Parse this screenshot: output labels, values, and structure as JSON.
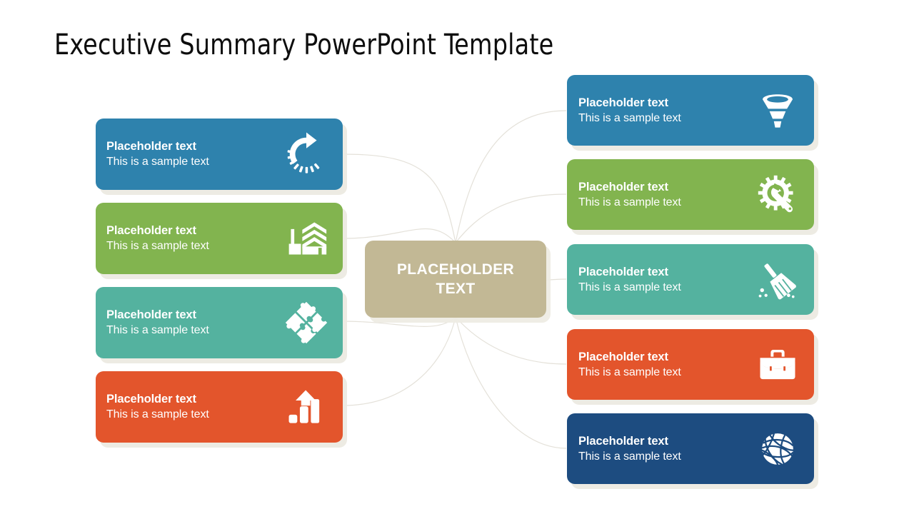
{
  "slide": {
    "title": "Executive Summary PowerPoint Template",
    "background_color": "#ffffff"
  },
  "center": {
    "label_line1": "PLACEHOLDER",
    "label_line2": "TEXT",
    "color": "#c2b895",
    "text_color": "#ffffff"
  },
  "connector_color": "#e4e1d9",
  "left_cards": [
    {
      "title": "Placeholder text",
      "subtitle": "This is a sample text",
      "color": "#2e82ad",
      "icon": "refresh-circular-arrow-icon"
    },
    {
      "title": "Placeholder text",
      "subtitle": "This is a sample text",
      "color": "#82b44f",
      "icon": "office-building-icon"
    },
    {
      "title": "Placeholder text",
      "subtitle": "This is a sample text",
      "color": "#54b29f",
      "icon": "puzzle-pieces-icon"
    },
    {
      "title": "Placeholder text",
      "subtitle": "This is a sample text",
      "color": "#e3552c",
      "icon": "growth-bar-chart-arrow-icon"
    }
  ],
  "right_cards": [
    {
      "title": "Placeholder text",
      "subtitle": "This is a sample text",
      "color": "#2e82ad",
      "icon": "funnel-icon"
    },
    {
      "title": "Placeholder text",
      "subtitle": "This is a sample text",
      "color": "#82b44f",
      "icon": "gear-wrench-icon"
    },
    {
      "title": "Placeholder text",
      "subtitle": "This is a sample text",
      "color": "#54b29f",
      "icon": "broom-icon"
    },
    {
      "title": "Placeholder text",
      "subtitle": "This is a sample text",
      "color": "#e3552c",
      "icon": "briefcase-icon"
    },
    {
      "title": "Placeholder text",
      "subtitle": "This is a sample text",
      "color": "#1d4c80",
      "icon": "globe-network-icon"
    }
  ]
}
